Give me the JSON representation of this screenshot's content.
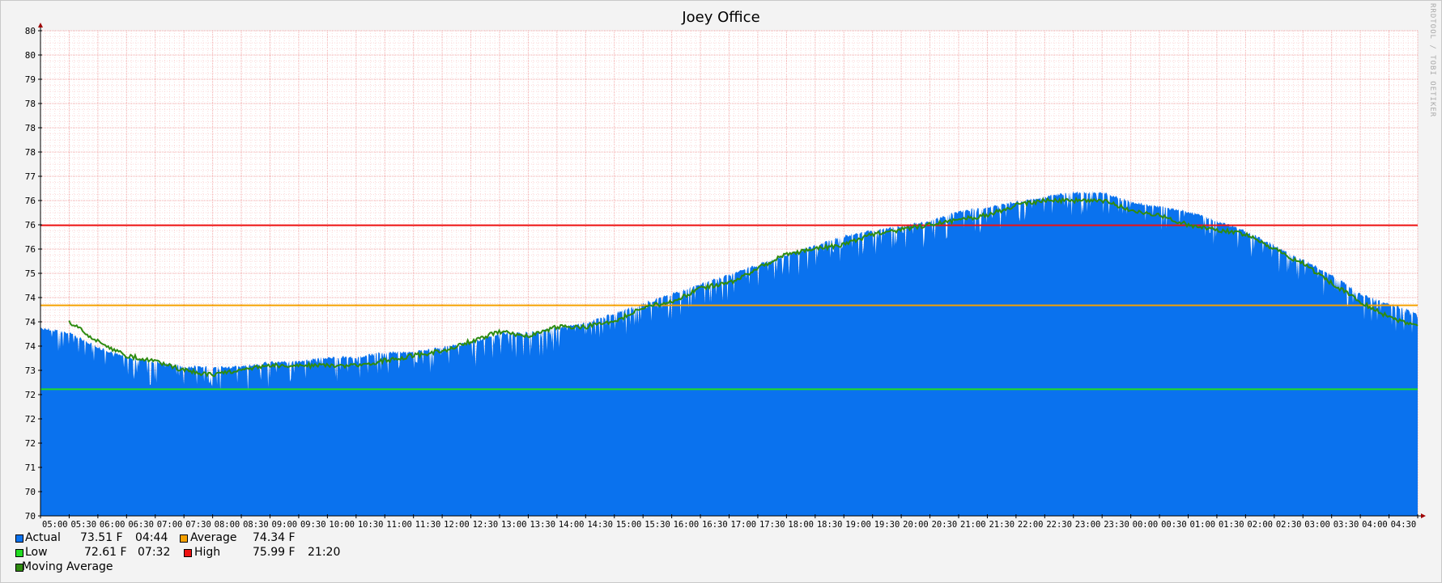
{
  "chart_data": {
    "type": "area",
    "title": "Joey Office",
    "watermark": "RRDTOOL / TOBI OETIKER",
    "x_ticks": [
      "05:00",
      "05:30",
      "06:00",
      "06:30",
      "07:00",
      "07:30",
      "08:00",
      "08:30",
      "09:00",
      "09:30",
      "10:00",
      "10:30",
      "11:00",
      "11:30",
      "12:00",
      "12:30",
      "13:00",
      "13:30",
      "14:00",
      "14:30",
      "15:00",
      "15:30",
      "16:00",
      "16:30",
      "17:00",
      "17:30",
      "18:00",
      "18:30",
      "19:00",
      "19:30",
      "20:00",
      "20:30",
      "21:00",
      "21:30",
      "22:00",
      "22:30",
      "23:00",
      "23:30",
      "00:00",
      "00:30",
      "01:00",
      "01:30",
      "02:00",
      "02:30",
      "03:00",
      "03:30",
      "04:00",
      "04:30"
    ],
    "y_tick_labels": [
      "70",
      "70",
      "71",
      "72",
      "72",
      "72",
      "73",
      "74",
      "74",
      "74",
      "75",
      "76",
      "76",
      "76",
      "77",
      "78",
      "78",
      "78",
      "79",
      "80",
      "80"
    ],
    "ylim": [
      70,
      80
    ],
    "xrange_hours": [
      0,
      24
    ],
    "grid": true,
    "series": [
      {
        "name": "Actual",
        "color": "#0a72ee",
        "style": "area",
        "x_hours": [
          0,
          0.5,
          1,
          1.5,
          2,
          2.5,
          3,
          3.5,
          4,
          4.5,
          5,
          5.5,
          6,
          6.5,
          7,
          7.5,
          8,
          8.5,
          9,
          9.5,
          10,
          10.5,
          11,
          11.5,
          12,
          12.5,
          13,
          13.5,
          14,
          14.5,
          15,
          15.5,
          16,
          16.5,
          17,
          17.5,
          18,
          18.5,
          19,
          19.5,
          20,
          20.5,
          21,
          21.5,
          22,
          22.5,
          23,
          23.5,
          24
        ],
        "values": [
          73.9,
          73.8,
          73.5,
          73.3,
          73.2,
          73.1,
          73.1,
          73.1,
          73.2,
          73.2,
          73.3,
          73.3,
          73.4,
          73.4,
          73.5,
          73.6,
          73.8,
          73.8,
          73.9,
          74.0,
          74.2,
          74.4,
          74.6,
          74.8,
          75.0,
          75.2,
          75.4,
          75.6,
          75.8,
          75.9,
          76.0,
          76.1,
          76.3,
          76.4,
          76.5,
          76.6,
          76.7,
          76.7,
          76.5,
          76.4,
          76.3,
          76.1,
          75.9,
          75.6,
          75.3,
          75.0,
          74.6,
          74.4,
          74.2
        ],
        "dip_amplitude": 0.55
      },
      {
        "name": "Moving Average",
        "color": "#2e8b10",
        "style": "line",
        "x_hours": [
          0.5,
          1,
          1.5,
          2,
          2.5,
          3,
          3.5,
          4,
          4.5,
          5,
          5.5,
          6,
          6.5,
          7,
          7.5,
          8,
          8.5,
          9,
          9.5,
          10,
          10.5,
          11,
          11.5,
          12,
          12.5,
          13,
          13.5,
          14,
          14.5,
          15,
          15.5,
          16,
          16.5,
          17,
          17.5,
          18,
          18.5,
          19,
          19.5,
          20,
          20.5,
          21,
          21.5,
          22,
          22.5,
          23,
          23.5,
          24
        ],
        "values": [
          74.0,
          73.6,
          73.3,
          73.2,
          73.0,
          72.9,
          73.0,
          73.1,
          73.1,
          73.1,
          73.1,
          73.2,
          73.3,
          73.4,
          73.6,
          73.8,
          73.7,
          73.9,
          73.9,
          74.0,
          74.3,
          74.4,
          74.7,
          74.8,
          75.1,
          75.4,
          75.5,
          75.6,
          75.8,
          75.9,
          76.0,
          76.1,
          76.2,
          76.4,
          76.5,
          76.5,
          76.5,
          76.3,
          76.2,
          76.0,
          75.9,
          75.8,
          75.5,
          75.2,
          74.8,
          74.4,
          74.1,
          73.9
        ]
      },
      {
        "name": "Average",
        "color": "#f5a000",
        "style": "hrule",
        "value": 74.34
      },
      {
        "name": "Low",
        "color": "#22dd22",
        "style": "hrule",
        "value": 72.61
      },
      {
        "name": "High",
        "color": "#ee1111",
        "style": "hrule",
        "value": 75.99
      }
    ],
    "legend": [
      {
        "label": "Actual",
        "value": "73.51 F",
        "time": "04:44",
        "color": "#0a72ee"
      },
      {
        "label": "Average",
        "value": "74.34 F",
        "time": "",
        "color": "#f5a000"
      },
      {
        "label": "Low",
        "value": "72.61 F",
        "time": "07:32",
        "color": "#22dd22"
      },
      {
        "label": "High",
        "value": "75.99 F",
        "time": "21:20",
        "color": "#ee1111"
      },
      {
        "label": "Moving Average",
        "value": "",
        "time": "",
        "color": "#2e8b10"
      }
    ]
  }
}
